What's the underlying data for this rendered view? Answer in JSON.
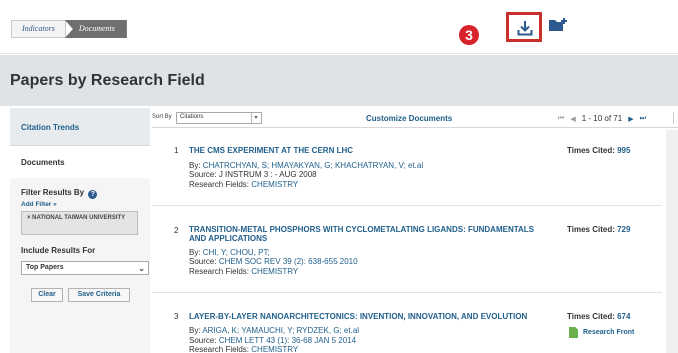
{
  "breadcrumb": {
    "items": [
      "Indicators",
      "Documents"
    ]
  },
  "header": {
    "step_badge": "3"
  },
  "page": {
    "title": "Papers by Research Field"
  },
  "sidebar": {
    "tabs": [
      "Citation Trends",
      "Documents"
    ],
    "filter_title": "Filter Results By",
    "help": "?",
    "add_filter": "Add Filter »",
    "filter_tag": "× NATIONAL TAIWAN UNIVERSITY",
    "include_label": "Include Results For",
    "include_value": "Top Papers",
    "clear_label": "Clear",
    "save_label": "Save Criteria"
  },
  "toolbar": {
    "sort_label": "Sort By",
    "sort_value": "Citations",
    "customize": "Customize Documents",
    "page_range": "1 - 10 of 71"
  },
  "records": [
    {
      "num": "1",
      "title": "THE CMS EXPERIMENT AT THE CERN LHC",
      "by_label": "By:",
      "authors": "CHATRCHYAN, S;  HMAYAKYAN, G;  KHACHATRYAN, V;  et.al",
      "source_label": "Source:",
      "source": "J INSTRUM 3 : - AUG 2008",
      "fields_label": "Research Fields:",
      "fields": "CHEMISTRY",
      "cited_label": "Times Cited:",
      "cited": "995"
    },
    {
      "num": "2",
      "title": "TRANSITION-METAL PHOSPHORS WITH CYCLOMETALATING LIGANDS: FUNDAMENTALS AND APPLICATIONS",
      "by_label": "By:",
      "authors": "CHI, Y;  CHOU, PT;",
      "source_label": "Source:",
      "source": "CHEM SOC REV 39 (2): 638-655 2010",
      "fields_label": "Research Fields:",
      "fields": "CHEMISTRY",
      "cited_label": "Times Cited:",
      "cited": "729"
    },
    {
      "num": "3",
      "title": "LAYER-BY-LAYER NANOARCHITECTONICS: INVENTION, INNOVATION, AND EVOLUTION",
      "by_label": "By:",
      "authors": "ARIGA, K;  YAMAUCHI, Y;  RYDZEK, G;  et.al",
      "source_label": "Source:",
      "source": "CHEM LETT 43 (1): 36-68 JAN 5 2014",
      "fields_label": "Research Fields:",
      "fields": "CHEMISTRY",
      "cited_label": "Times Cited:",
      "cited": "674",
      "research_front": "Research Front"
    }
  ],
  "colors": {
    "accent": "#1f5f8b",
    "highlight": "#c9302c",
    "badge": "#d8222a"
  }
}
